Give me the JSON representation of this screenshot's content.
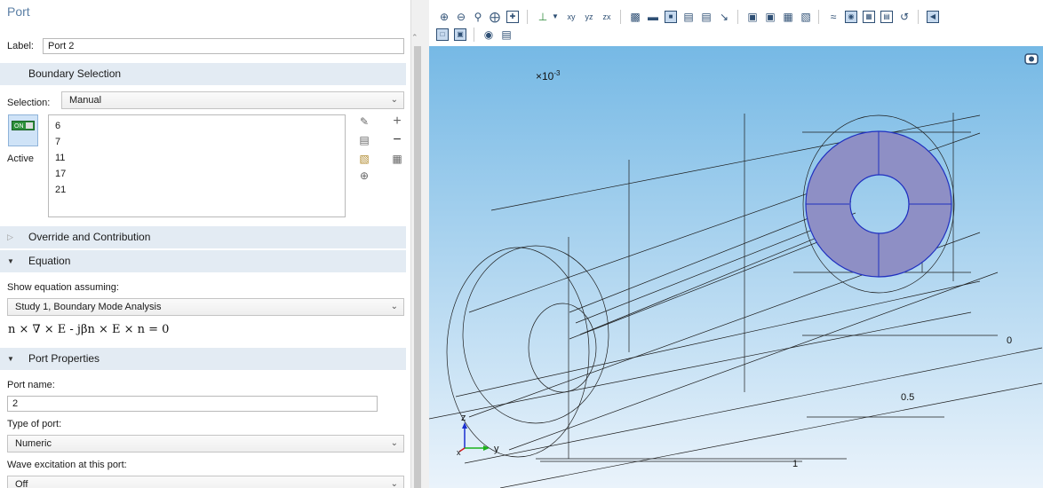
{
  "panel": {
    "title": "Port",
    "label_caption": "Label:",
    "label_value": "Port 2"
  },
  "boundary_selection": {
    "header": "Boundary Selection",
    "selection_caption": "Selection:",
    "selection_value": "Manual",
    "items": [
      "6",
      "7",
      "11",
      "17",
      "21"
    ],
    "active_label": "Active",
    "switch_text": "ON"
  },
  "override": {
    "header": "Override and Contribution"
  },
  "equation": {
    "header": "Equation",
    "show_caption": "Show equation assuming:",
    "study_value": "Study 1, Boundary Mode Analysis",
    "formula": "n × ∇ × E - jβn × E × n = 0"
  },
  "port_properties": {
    "header": "Port Properties",
    "port_name_caption": "Port name:",
    "port_name_value": "2",
    "type_caption": "Type of port:",
    "type_value": "Numeric",
    "wave_caption": "Wave excitation at this port:",
    "wave_value": "Off"
  },
  "graphics": {
    "scale_label": "×10",
    "scale_exp": "-3",
    "axis_labels": [
      "0",
      "0.5",
      "1"
    ],
    "triad": {
      "z": "z",
      "y": "y",
      "x": "x"
    },
    "colors": {
      "background_top": "#76b9e5",
      "background_bottom": "#eaf3fb",
      "highlight_fill": "#8e8fc5",
      "highlight_edge": "#2030c0",
      "wire": "#1c1c1c"
    }
  },
  "icons": {
    "toolbar": [
      "zoom-in-icon",
      "zoom-out-icon",
      "zoom-box-icon",
      "zoom-selected-icon",
      "zoom-extents-icon",
      "axis-orientation-icon",
      "view-xy-icon",
      "view-yz-icon",
      "view-zx-icon",
      "transparency-icon",
      "wireframe-icon",
      "render-icon",
      "select-boundaries-icon",
      "select-edges-icon",
      "select-points-icon",
      "scene-light-icon",
      "grid-icon",
      "measure-icon",
      "clear-selection-icon",
      "hide-icon",
      "show-hidden-icon",
      "reset-hiding-icon",
      "undo-icon",
      "go-to-default-view-icon",
      "views-icon",
      "camera-icon",
      "print-icon"
    ]
  }
}
